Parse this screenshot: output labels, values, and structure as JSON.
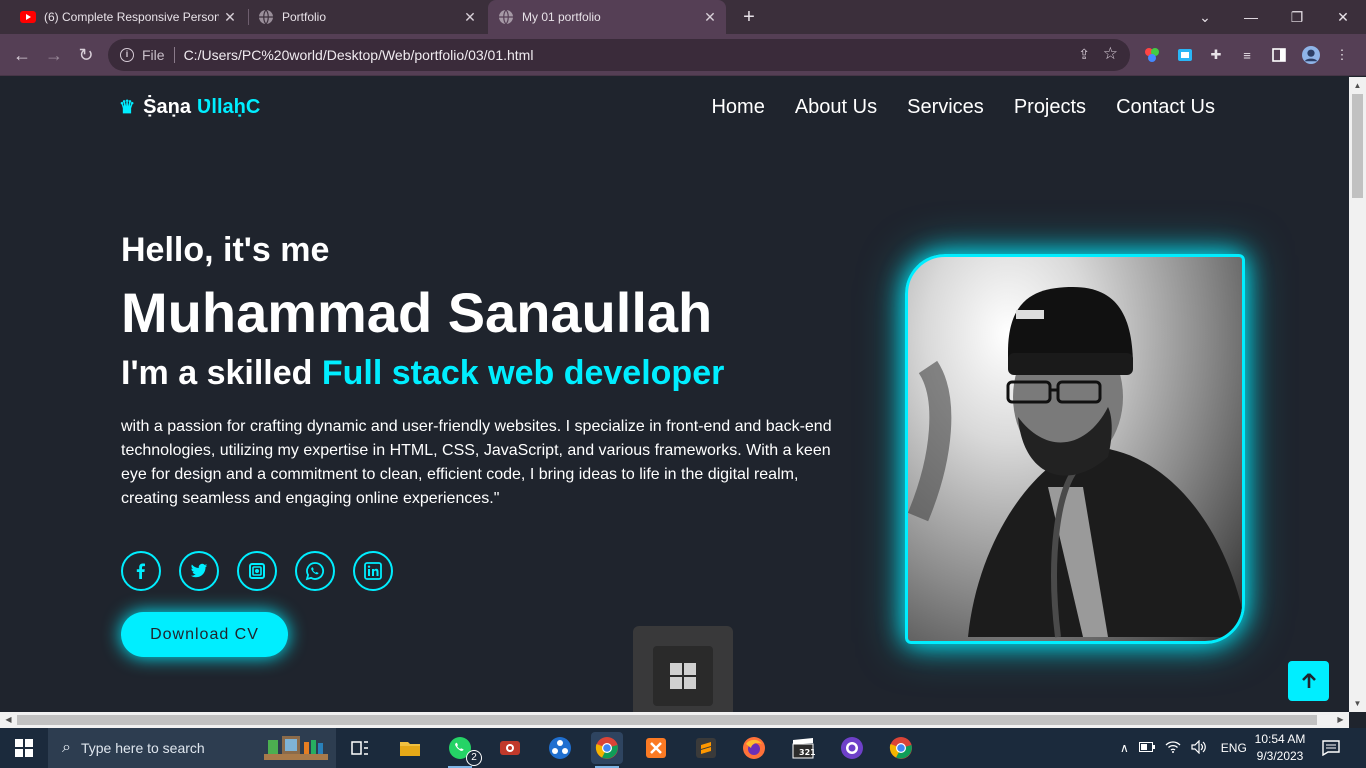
{
  "browser": {
    "tabs": [
      {
        "title": "(6) Complete Responsive Persona",
        "favicon": "youtube-icon",
        "active": false
      },
      {
        "title": "Portfolio",
        "favicon": "globe-icon",
        "active": false
      },
      {
        "title": "My 01 portfolio",
        "favicon": "globe-icon",
        "active": true
      }
    ],
    "address": {
      "scheme": "File",
      "url": "C:/Users/PC%20world/Desktop/Web/portfolio/03/01.html"
    }
  },
  "site": {
    "logo": {
      "first": "Ṩaṇa",
      "second": "ƲllaḥC"
    },
    "nav": [
      "Home",
      "About Us",
      "Services",
      "Projects",
      "Contact Us"
    ],
    "hero": {
      "greeting": "Hello, it's me",
      "name": "Muhammad Sanaullah",
      "skill_prefix": "I'm a skilled",
      "skill_highlight": "Full stack web developer",
      "description": "with a passion for crafting dynamic and user-friendly websites. I specialize in front-end and back-end technologies, utilizing my expertise in HTML, CSS, JavaScript, and various frameworks. With a keen eye for design and a commitment to clean, efficient code, I bring ideas to life in the digital realm, creating seamless and engaging online experiences.\"",
      "cta": "Download CV",
      "socials": [
        "facebook-icon",
        "twitter-icon",
        "instagram-icon",
        "whatsapp-icon",
        "linkedin-icon"
      ]
    },
    "colors": {
      "accent": "#00eeff",
      "background": "#1f242d",
      "text": "#ffffff"
    }
  },
  "taskbar": {
    "search_placeholder": "Type here to search",
    "whatsapp_badge": "2",
    "language": "ENG",
    "time": "10:54 AM",
    "date": "9/3/2023"
  }
}
